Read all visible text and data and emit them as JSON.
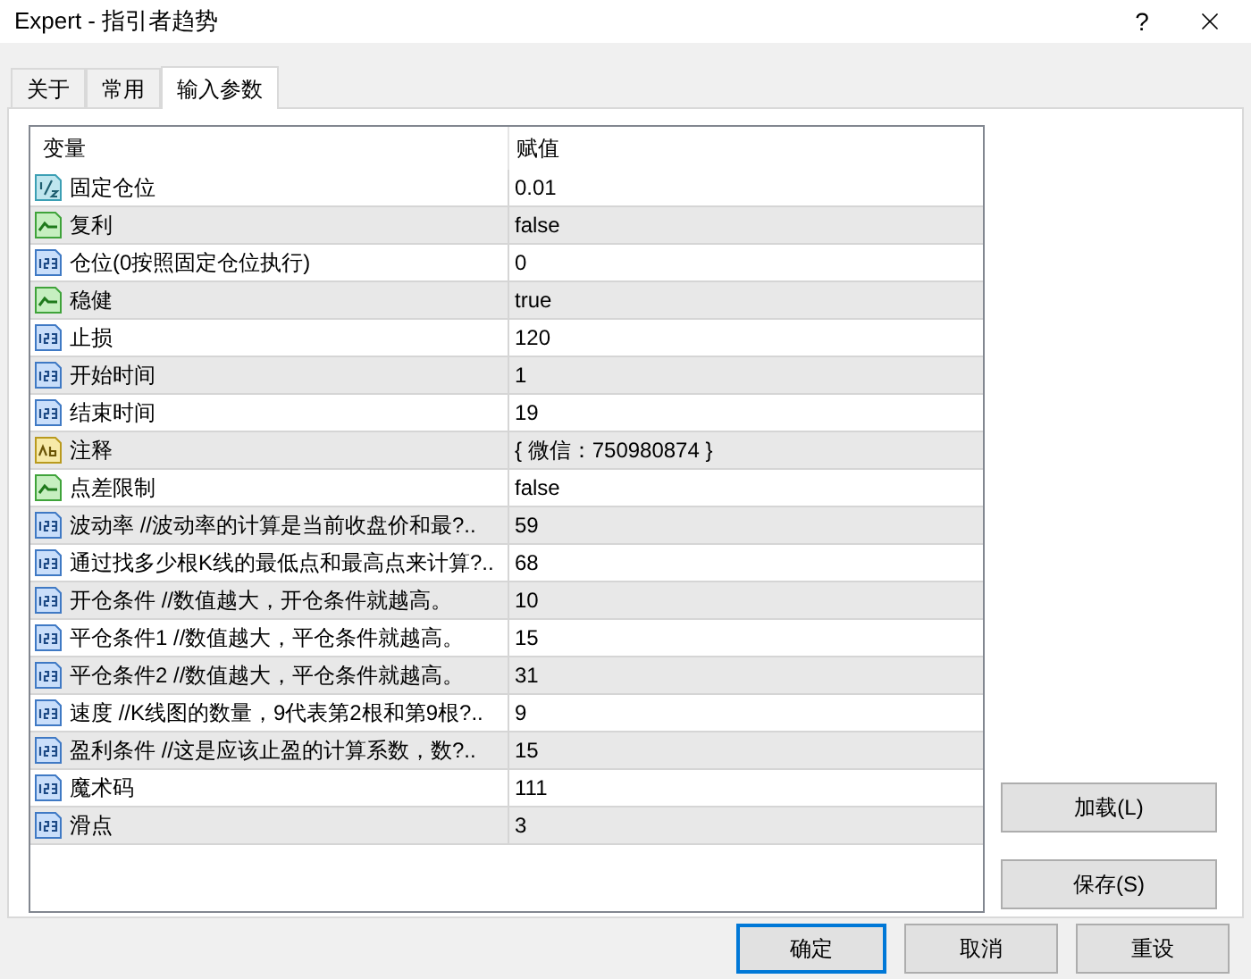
{
  "window": {
    "title": "Expert - 指引者趋势",
    "help": "?"
  },
  "tabs": [
    {
      "label": "关于",
      "selected": false
    },
    {
      "label": "常用",
      "selected": false
    },
    {
      "label": "输入参数",
      "selected": true
    }
  ],
  "table": {
    "columns": [
      "变量",
      "赋值"
    ],
    "rows": [
      {
        "kind": "double",
        "name": "固定仓位",
        "value": "0.01"
      },
      {
        "kind": "bool",
        "name": "复利",
        "value": "false"
      },
      {
        "kind": "int",
        "name": "仓位(0按照固定仓位执行)",
        "value": "0"
      },
      {
        "kind": "bool",
        "name": "稳健",
        "value": "true"
      },
      {
        "kind": "int",
        "name": "止损",
        "value": "120"
      },
      {
        "kind": "int",
        "name": "开始时间",
        "value": "1"
      },
      {
        "kind": "int",
        "name": "结束时间",
        "value": "19"
      },
      {
        "kind": "string",
        "name": "注释",
        "value": "{ 微信：750980874 }"
      },
      {
        "kind": "bool",
        "name": "点差限制",
        "value": "false"
      },
      {
        "kind": "int",
        "name": "波动率  //波动率的计算是当前收盘价和最?..",
        "value": "59"
      },
      {
        "kind": "int",
        "name": "通过找多少根K线的最低点和最高点来计算?..",
        "value": "68"
      },
      {
        "kind": "int",
        "name": "开仓条件  //数值越大，开仓条件就越高。",
        "value": "10"
      },
      {
        "kind": "int",
        "name": "平仓条件1  //数值越大，平仓条件就越高。",
        "value": "15"
      },
      {
        "kind": "int",
        "name": "平仓条件2  //数值越大，平仓条件就越高。",
        "value": "31"
      },
      {
        "kind": "int",
        "name": "速度  //K线图的数量，9代表第2根和第9根?..",
        "value": "9"
      },
      {
        "kind": "int",
        "name": "盈利条件  //这是应该止盈的计算系数，数?..",
        "value": "15"
      },
      {
        "kind": "int",
        "name": "魔术码",
        "value": "111"
      },
      {
        "kind": "int",
        "name": "滑点",
        "value": "3"
      }
    ]
  },
  "side_buttons": [
    "加载(L)",
    "保存(S)"
  ],
  "buttons": [
    {
      "label": "确定",
      "selected": true
    },
    {
      "label": "取消",
      "selected": false
    },
    {
      "label": "重设",
      "selected": false
    }
  ]
}
